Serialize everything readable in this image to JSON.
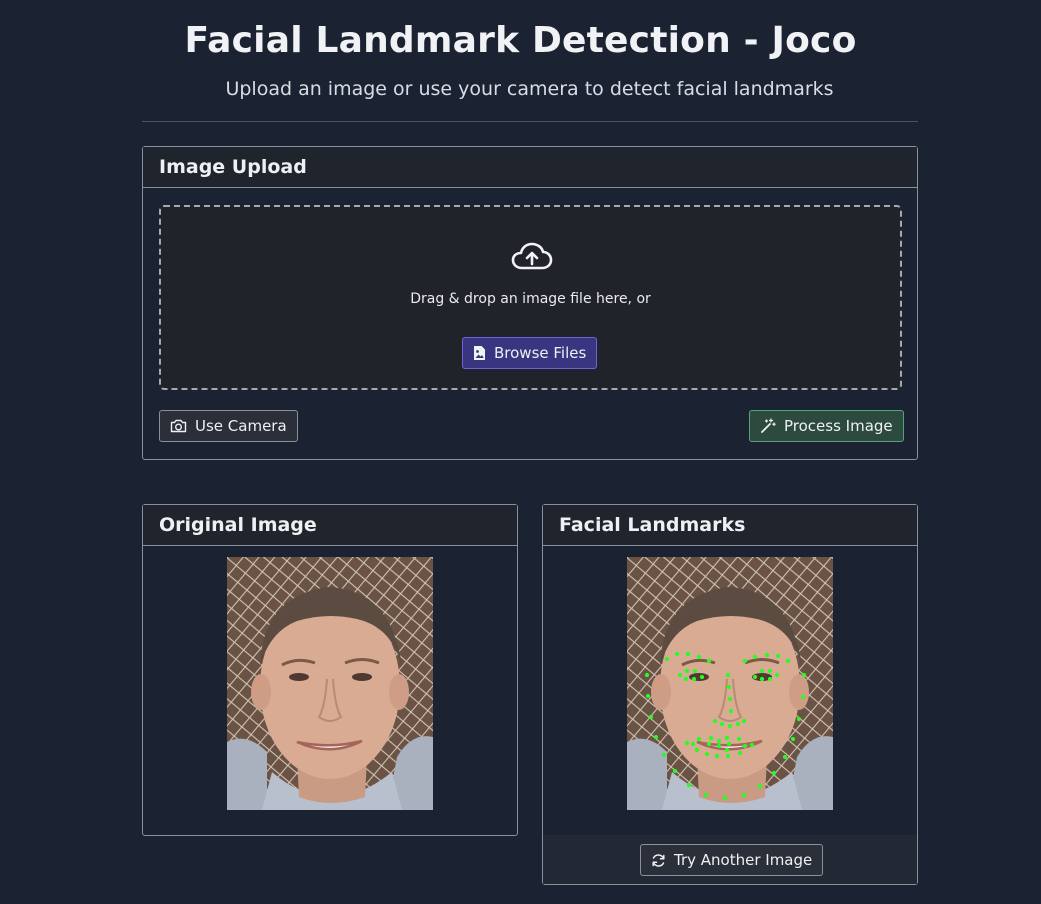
{
  "header": {
    "title": "Facial Landmark Detection - Joco",
    "subtitle": "Upload an image or use your camera to detect facial landmarks"
  },
  "upload": {
    "card_title": "Image Upload",
    "drop_text": "Drag & drop an image file here, or",
    "browse_label": "Browse Files",
    "camera_label": "Use Camera",
    "process_label": "Process Image",
    "icons": {
      "upload": "cloud-upload-icon",
      "browse": "file-image-icon",
      "camera": "camera-icon",
      "process": "magic-wand-icon"
    }
  },
  "original": {
    "card_title": "Original Image"
  },
  "landmarks": {
    "card_title": "Facial Landmarks",
    "try_label": "Try Another Image",
    "landmark_color": "#22ff22",
    "icons": {
      "retry": "refresh-icon"
    }
  },
  "colors": {
    "background": "#1b2232",
    "primary_button": "#3a3580",
    "success_button": "#2d4a3e"
  }
}
